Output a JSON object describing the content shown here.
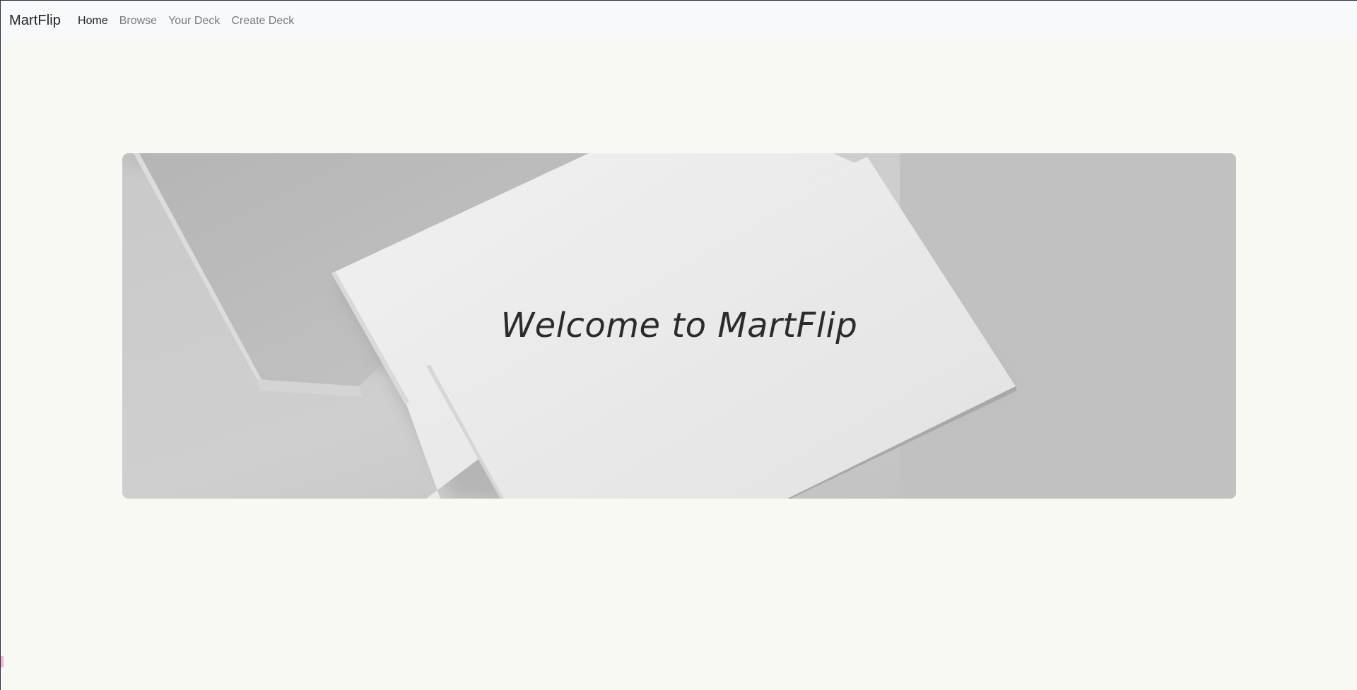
{
  "navbar": {
    "brand": "MartFlip",
    "links": [
      {
        "label": "Home",
        "active": true
      },
      {
        "label": "Browse",
        "active": false
      },
      {
        "label": "Your Deck",
        "active": false
      },
      {
        "label": "Create Deck",
        "active": false
      }
    ]
  },
  "hero": {
    "title": "Welcome to MartFlip",
    "image_subject": "blank white business cards on grey surface"
  },
  "colors": {
    "page_background": "#f9f9f3",
    "navbar_background": "#f8f9fa",
    "hero_background": "#c0c0c0",
    "text_primary": "#212529",
    "text_muted": "#7a7a7a"
  }
}
